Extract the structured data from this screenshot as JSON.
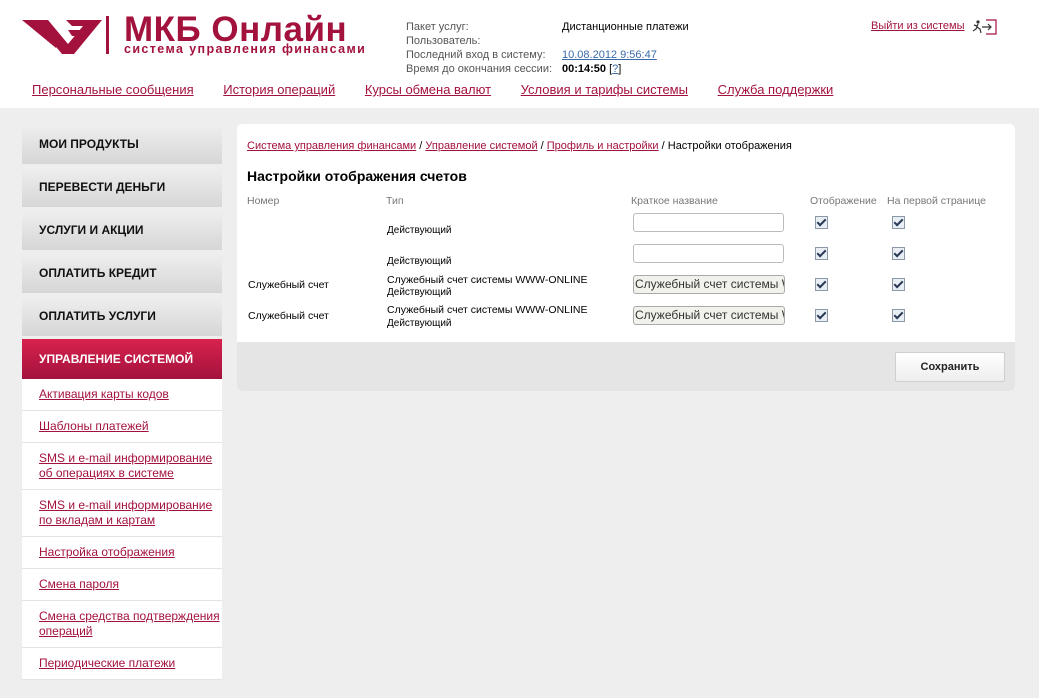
{
  "header": {
    "logo": {
      "title": "МКБ Онлайн",
      "subtitle": "система управления финансами"
    },
    "info": {
      "package_label": "Пакет услуг:",
      "package_value": "Дистанционные платежи",
      "user_label": "Пользователь:",
      "user_value": "",
      "last_login_label": "Последний вход в систему:",
      "last_login_value": "10.08.2012 9:56:47",
      "session_label": "Время до окончания сессии:",
      "session_value": "00:14:50",
      "help_link": "?"
    },
    "logout_label": "Выйти из системы"
  },
  "topnav": [
    "Персональные сообщения",
    "История операций",
    "Курсы обмена валют",
    "Условия и тарифы системы",
    "Служба поддержки"
  ],
  "sidebar": {
    "buttons": [
      "МОИ ПРОДУКТЫ",
      "ПЕРЕВЕСТИ ДЕНЬГИ",
      "УСЛУГИ И АКЦИИ",
      "ОПЛАТИТЬ КРЕДИТ",
      "ОПЛАТИТЬ УСЛУГИ",
      "УПРАВЛЕНИЕ СИСТЕМОЙ"
    ],
    "submenu": [
      "Активация карты кодов",
      "Шаблоны платежей",
      "SMS и e-mail информирование об операциях в системе",
      "SMS и e-mail информирование по вкладам и картам",
      "Настройка отображения",
      "Смена пароля",
      "Смена средства подтверждения операций",
      "Периодические платежи"
    ]
  },
  "breadcrumb": {
    "items": [
      "Система управления финансами",
      "Управление системой",
      "Профиль и настройки"
    ],
    "separator": " / ",
    "current": "Настройки отображения"
  },
  "page_title": "Настройки отображения счетов",
  "table": {
    "headers": [
      "Номер",
      "Тип",
      "Краткое название",
      "Отображение",
      "На первой странице"
    ],
    "rows": [
      {
        "number": "",
        "type_line1": "",
        "type_line2": "Действующий",
        "short_name": "",
        "display": true,
        "first_page": true
      },
      {
        "number": "",
        "type_line1": "",
        "type_line2": "Действующий",
        "short_name": "",
        "display": true,
        "first_page": true
      },
      {
        "number": "Служебный счет",
        "type_line1": "Служебный счет системы WWW-ONLINE",
        "type_line2": "Действующий",
        "short_name": "Служебный счет системы WWW-ONLINE",
        "display": true,
        "first_page": true
      },
      {
        "number": "Служебный счет",
        "type_line1": "Служебный счет системы WWW-ONLINE",
        "type_line2": "Действующий",
        "short_name": "Служебный счет системы WWW-ONLINE",
        "display": true,
        "first_page": true
      }
    ]
  },
  "save_label": "Сохранить",
  "colors": {
    "brand": "#a3123d",
    "link_blue": "#3a6aa8"
  }
}
